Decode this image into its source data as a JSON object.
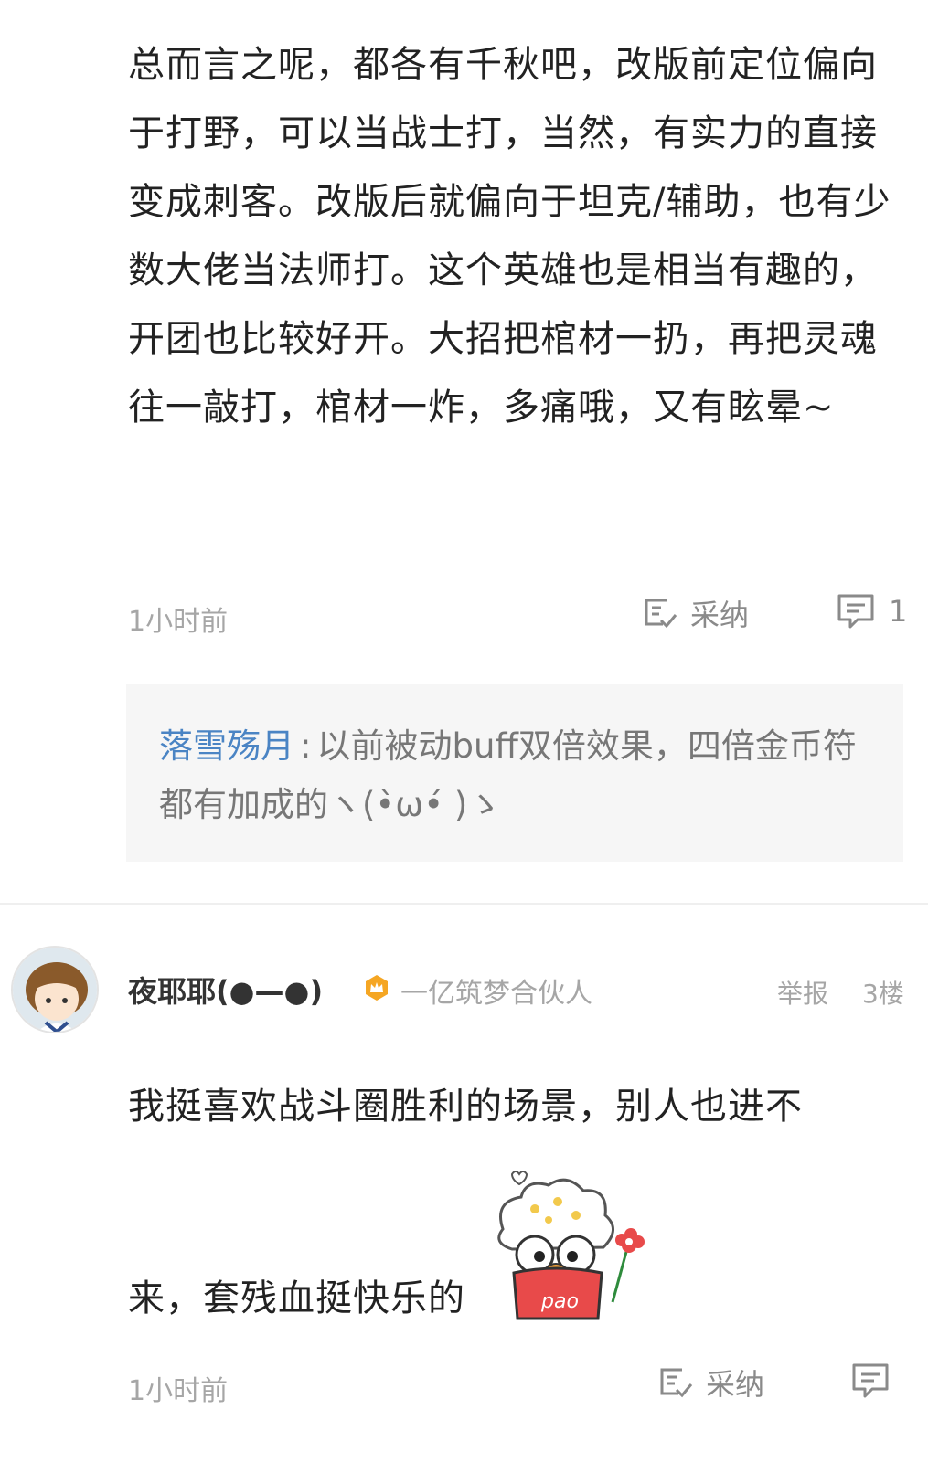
{
  "reply_prev": {
    "text": "总而言之呢，都各有千秋吧，改版前定位偏向于打野，可以当战士打，当然，有实力的直接变成刺客。改版后就偏向于坦克/辅助，也有少数大佬当法师打。这个英雄也是相当有趣的，开团也比较好开。大招把棺材一扔，再把灵魂往一敲打，棺材一炸，多痛哦，又有眩晕~",
    "time": "1小时前",
    "accept_label": "采纳",
    "comment_count": "1",
    "sub_reply": {
      "username": "落雪殇月",
      "separator": ":",
      "text": "以前被动buff双倍效果，四倍金币符都有加成的ヽ(•̀ω•́ )ゝ"
    }
  },
  "reply_floor3": {
    "author_name": "夜耶耶(●—●)",
    "author_title": "一亿筑梦合伙人",
    "report_label": "举报",
    "floor": "3楼",
    "text_line1": "我挺喜欢战斗圈胜利的场景，别人也进不",
    "text_line2": "来，套残血挺快乐的",
    "sticker_text": "pao",
    "time": "1小时前",
    "accept_label": "采纳"
  },
  "icons": {
    "accept": "accept-edit-icon",
    "comment": "comment-bubble-icon",
    "badge": "crown-badge-icon"
  },
  "colors": {
    "username_link": "#4a84c4",
    "meta_gray": "#a6a6a6",
    "badge_orange": "#f5a623",
    "sub_reply_bg": "#f6f6f6"
  }
}
